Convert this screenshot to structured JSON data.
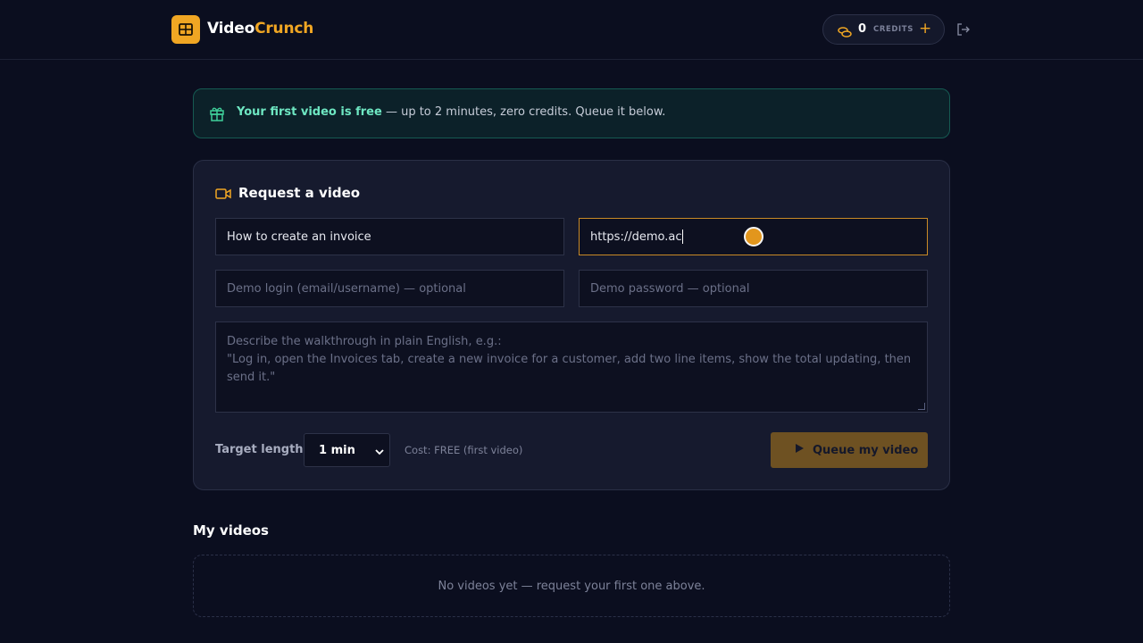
{
  "header": {
    "brand_part1": "Video",
    "brand_part2": "Crunch",
    "credits_count": "0",
    "credits_label": "CREDITS",
    "add_credits": "+"
  },
  "banner": {
    "bold": "Your first video is free",
    "rest": " — up to 2 minutes, zero credits. Queue it below."
  },
  "request": {
    "title": "Request a video",
    "title_field_value": "How to create an invoice",
    "url_field_value": "https://demo.ac",
    "login_placeholder": "Demo login (email/username) — optional",
    "password_placeholder": "Demo password — optional",
    "description_placeholder_line1": "Describe the walkthrough in plain English, e.g.:",
    "description_placeholder_line2": "\"Log in, open the Invoices tab, create a new invoice for a customer, add two line items, show the total updating, then send it.\"",
    "target_length_label": "Target length:",
    "target_length_value": "1 min",
    "cost_text": "Cost: FREE (first video)",
    "queue_button": "Queue my video"
  },
  "videos": {
    "heading": "My videos",
    "empty_text": "No videos yet — request your first one above."
  },
  "colors": {
    "accent": "#f0a623",
    "background": "#0b0e1f",
    "card": "#161a2e",
    "banner_highlight": "#6ee7c2"
  },
  "icons": [
    "film-logo-icon",
    "coins-icon",
    "logout-icon",
    "gift-icon",
    "video-camera-icon",
    "play-icon",
    "chevron-down-icon"
  ]
}
